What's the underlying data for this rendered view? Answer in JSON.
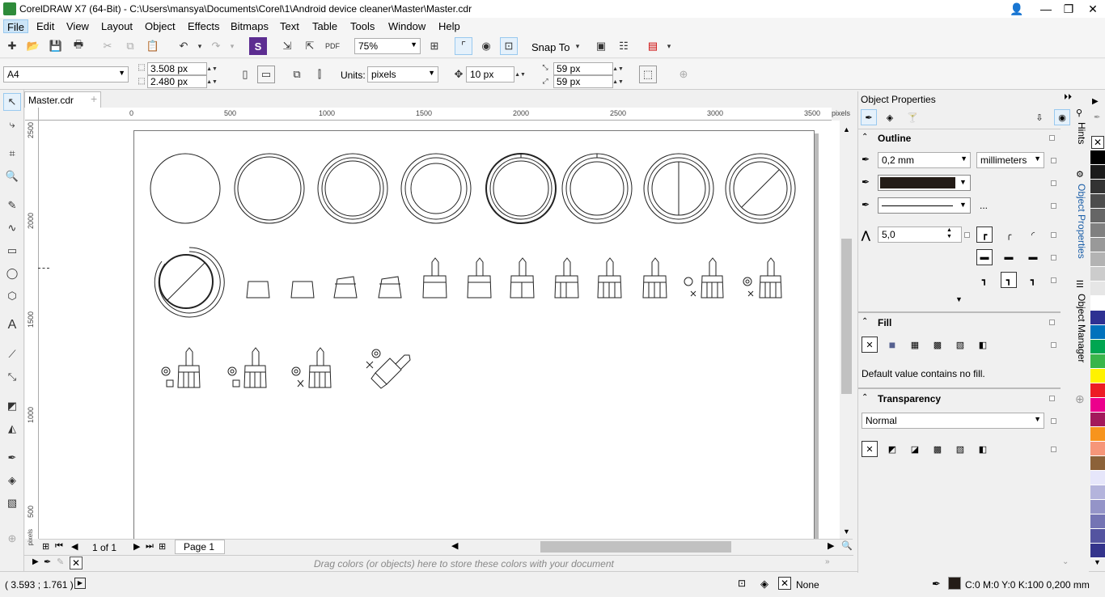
{
  "window": {
    "title": "CorelDRAW X7 (64-Bit) - C:\\Users\\mansya\\Documents\\Corel\\1\\Android device cleaner\\Master\\Master.cdr"
  },
  "menu": [
    "File",
    "Edit",
    "View",
    "Layout",
    "Object",
    "Effects",
    "Bitmaps",
    "Text",
    "Table",
    "Tools",
    "Window",
    "Help"
  ],
  "toolbar": {
    "zoom": "75%",
    "snap_to": "Snap To"
  },
  "property_bar": {
    "page_size": "A4",
    "width": "3.508 px",
    "height": "2.480 px",
    "units_label": "Units:",
    "units": "pixels",
    "nudge": "10 px",
    "dup_x": "59 px",
    "dup_y": "59 px"
  },
  "document_tab": "Master.cdr",
  "ruler": {
    "unit": "pixels",
    "h_ticks": [
      "0",
      "500",
      "1000",
      "1500",
      "2000",
      "2500",
      "3000",
      "3500"
    ],
    "v_ticks": [
      "2500",
      "2000",
      "1500",
      "1000",
      "500"
    ],
    "v_unit": "pixels"
  },
  "page_nav": {
    "count": "1 of 1",
    "page_tab": "Page 1"
  },
  "palette_bar": {
    "hint": "Drag colors (or objects) here to store these colors with your document"
  },
  "status": {
    "coords": "( 3.593 ; 1.761 )",
    "fill": "None",
    "outline": "C:0 M:0 Y:0 K:100  0,200 mm"
  },
  "docker": {
    "title": "Object Properties",
    "outline": {
      "heading": "Outline",
      "width": "0,2 mm",
      "units": "millimeters",
      "miter": "5,0",
      "more": "..."
    },
    "fill": {
      "heading": "Fill",
      "message": "Default value contains no fill."
    },
    "transparency": {
      "heading": "Transparency",
      "mode": "Normal"
    },
    "tabs": [
      "Hints",
      "Object Properties",
      "Object Manager"
    ]
  },
  "colors": {
    "palette": [
      "#ffffff",
      "#000000",
      "#1a1a1a",
      "#333333",
      "#4d4d4d",
      "#666666",
      "#808080",
      "#999999",
      "#b3b3b3",
      "#cccccc",
      "#e6e6e6",
      "#ffffff",
      "#2e3192",
      "#0072bc",
      "#00a651",
      "#39b54a",
      "#fff200",
      "#ed1c24",
      "#ec008c",
      "#a3195b",
      "#f7941d",
      "#f69679",
      "#8c6239",
      "#e6e6fa",
      "#b4b4dc",
      "#9494c8",
      "#7474b4",
      "#5454a0",
      "#34348c",
      "#ffffff"
    ],
    "outline_swatch": "#241c17"
  },
  "icons": [
    "pick-icon",
    "shape-icon",
    "crop-icon",
    "zoom-icon",
    "freehand-icon",
    "artistic-media-icon",
    "rectangle-icon",
    "ellipse-icon",
    "polygon-icon",
    "text-icon",
    "parallel-dimension-icon",
    "connector-icon",
    "drop-shadow-icon",
    "transparency-icon",
    "eyedropper-icon",
    "interactive-fill-icon",
    "smart-fill-icon"
  ]
}
